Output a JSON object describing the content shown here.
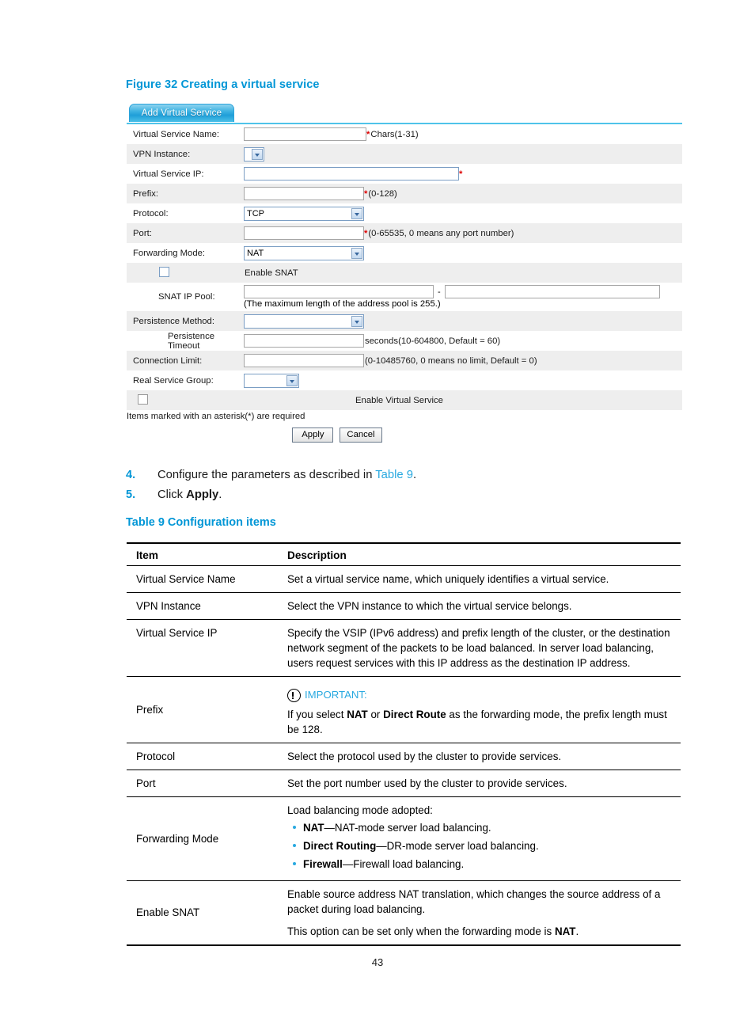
{
  "figure": {
    "caption": "Figure 32 Creating a virtual service"
  },
  "dialog": {
    "tab_label": "Add Virtual Service",
    "fields": {
      "virtual_service_name": {
        "label": "Virtual Service Name:",
        "value": "",
        "hint_star": "*",
        "hint": "Chars(1-31)"
      },
      "vpn_instance": {
        "label": "VPN Instance:",
        "value": ""
      },
      "virtual_service_ip": {
        "label": "Virtual Service IP:",
        "value": "",
        "hint_star": "*",
        "hint": ""
      },
      "prefix": {
        "label": "Prefix:",
        "value": "",
        "hint_star": "*",
        "hint": "(0-128)"
      },
      "protocol": {
        "label": "Protocol:",
        "value": "TCP"
      },
      "port": {
        "label": "Port:",
        "value": "",
        "hint_star": "*",
        "hint": "(0-65535, 0 means any port number)"
      },
      "forwarding_mode": {
        "label": "Forwarding Mode:",
        "value": "NAT"
      },
      "enable_snat": {
        "label": "Enable SNAT",
        "checked": false
      },
      "snat_ip_pool": {
        "label": "SNAT IP Pool:",
        "start": "",
        "end": "",
        "separator": "-",
        "note": "(The maximum length of the address pool is 255.)"
      },
      "persistence_method": {
        "label": "Persistence Method:",
        "value": ""
      },
      "persistence_timeout": {
        "label": "Persistence Timeout",
        "value": "",
        "hint": "seconds(10-604800, Default = 60)"
      },
      "connection_limit": {
        "label": "Connection Limit:",
        "value": "",
        "hint": "(0-10485760, 0 means no limit, Default = 0)"
      },
      "real_service_group": {
        "label": "Real Service Group:",
        "value": ""
      },
      "enable_virtual_service": {
        "label": "Enable Virtual Service",
        "checked": false
      }
    },
    "required_note": "Items marked with an asterisk(*) are required",
    "apply_label": "Apply",
    "cancel_label": "Cancel"
  },
  "steps": [
    {
      "num": "4.",
      "text_a": "Configure the parameters as described in ",
      "link": "Table 9",
      "text_b": "."
    },
    {
      "num": "5.",
      "text_a": "Click ",
      "bold": "Apply",
      "text_b": "."
    }
  ],
  "table9": {
    "caption": "Table 9 Configuration items",
    "headers": {
      "item": "Item",
      "description": "Description"
    },
    "rows": [
      {
        "item": "Virtual Service Name",
        "desc": "Set a virtual service name, which uniquely identifies a virtual service."
      },
      {
        "item": "VPN Instance",
        "desc": "Select the VPN instance to which the virtual service belongs."
      },
      {
        "item": "Virtual Service IP",
        "desc": "Specify the VSIP (IPv6 address) and prefix length of the cluster, or the destination network segment of the packets to be load balanced. In server load balancing, users request services with this IP address as the destination IP address."
      },
      {
        "item": "Prefix",
        "important_label": "IMPORTANT:",
        "imp_a": "If you select ",
        "imp_b1": "NAT",
        "imp_mid": " or ",
        "imp_b2": "Direct Route",
        "imp_c": " as the forwarding mode, the prefix length must be 128."
      },
      {
        "item": "Protocol",
        "desc": "Select the protocol used by the cluster to provide services."
      },
      {
        "item": "Port",
        "desc": "Set the port number used by the cluster to provide services."
      },
      {
        "item": "Forwarding Mode",
        "desc": "Load balancing mode adopted:",
        "bullets": [
          {
            "bold": "NAT",
            "rest": "—NAT-mode server load balancing."
          },
          {
            "bold": "Direct Routing",
            "rest": "—DR-mode server load balancing."
          },
          {
            "bold": "Firewall",
            "rest": "—Firewall load balancing."
          }
        ]
      },
      {
        "item": "Enable SNAT",
        "desc": "Enable source address NAT translation, which changes the source address of a packet during load balancing.",
        "desc2_a": "This option can be set only when the forwarding mode is ",
        "desc2_b": "NAT",
        "desc2_c": "."
      }
    ]
  },
  "page_number": "43",
  "colors": {
    "accent_blue": "#0096d6",
    "link_blue": "#29a9e0",
    "tab_blue": "#2ba3da",
    "row_alt": "#eeeeee",
    "required_star": "#dd0000"
  }
}
